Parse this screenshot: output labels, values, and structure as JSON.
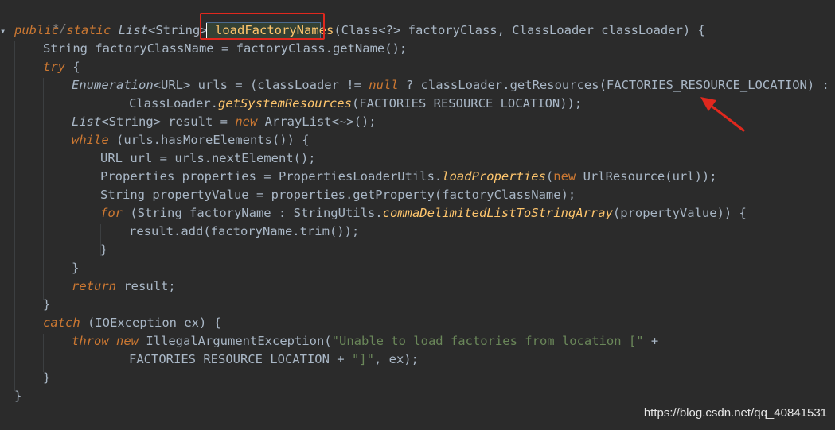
{
  "code": {
    "l0": "*/",
    "l1_public": "public",
    "l1_static": "static",
    "l1_list": "List",
    "l1_string": "<String>",
    "l1_method": "loadFactoryNames",
    "l1_rest": "(Class<?> factoryClass, ClassLoader classLoader) {",
    "l2": "String factoryClassName = factoryClass.getName();",
    "l3_try": "try",
    "l3_rest": " {",
    "l4_enum": "Enumeration",
    "l4_a": "<URL> urls = (classLoader != ",
    "l4_null": "null",
    "l4_b": " ? classLoader.getResources(FACTORIES_RESOURCE_LOCATION) :",
    "l5_a": "ClassLoader.",
    "l5_m": "getSystemResources",
    "l5_b": "(FACTORIES_RESOURCE_LOCATION));",
    "l6_list": "List",
    "l6_a": "<String> result = ",
    "l6_new": "new",
    "l6_b": " ArrayList<~>();",
    "l7_while": "while",
    "l7_rest": " (urls.hasMoreElements()) {",
    "l8": "URL url = urls.nextElement();",
    "l9_a": "Properties properties = PropertiesLoaderUtils.",
    "l9_m": "loadProperties",
    "l9_b": "(",
    "l9_new": "new",
    "l9_c": " UrlResource(url));",
    "l10": "String propertyValue = properties.getProperty(factoryClassName);",
    "l11_for": "for",
    "l11_a": " (String factoryName : StringUtils.",
    "l11_m": "commaDelimitedListToStringArray",
    "l11_b": "(propertyValue)) {",
    "l12": "result.add(factoryName.trim());",
    "l13": "}",
    "l14": "}",
    "l15_ret": "return",
    "l15_rest": " result;",
    "l16": "}",
    "l17_catch": "catch",
    "l17_rest": " (IOException ex) {",
    "l18_throw": "throw",
    "l18_new": "new",
    "l18_a": " IllegalArgumentException(",
    "l18_str": "\"Unable to load factories from location [\"",
    "l18_b": " +",
    "l19_a": "FACTORIES_RESOURCE_LOCATION + ",
    "l19_str": "\"]\"",
    "l19_b": ", ex);",
    "l20": "}",
    "l21": "}"
  },
  "watermark": "https://blog.csdn.net/qq_40841531",
  "colors": {
    "background": "#2b2b2b",
    "keyword": "#cc7832",
    "annotation_box": "#e0281e",
    "arrow": "#e0281e"
  }
}
